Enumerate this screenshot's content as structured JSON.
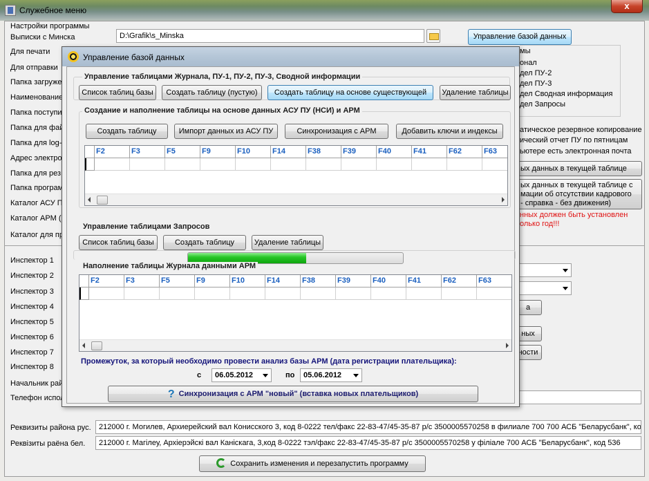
{
  "main": {
    "title": "Служебное меню",
    "close_label": "x",
    "settings_label": "Настройки программы",
    "left_labels": [
      "Выписки с Минска",
      "Для печати",
      "Для отправки",
      "Папка загруже",
      "Наименование",
      "Папка поступи",
      "Папка для фай",
      "Папка для log-",
      "Адрес электро",
      "Папка для рез",
      "Папка програм",
      "Каталог АСУ П",
      "Каталог АРМ (",
      "Каталог для пр"
    ],
    "minsk_path": "D:\\Grafik\\s_Minska",
    "db_button": "Управление базой данных",
    "right_labels": [
      "мы",
      "онал",
      "дел ПУ-2",
      "дел ПУ-3",
      "дел Сводная информация",
      "дел Запросы"
    ],
    "checkbox_labels": [
      "атическое резервное копирование",
      "ический отчет ПУ по пятницам",
      "ьютере есть электронная почта"
    ],
    "btn_current_table": "ых данных в текущей таблице",
    "btn_multi": [
      "ых данных в текущей таблице с",
      "мации об отсутствии кадрового",
      " - справка - без движения)"
    ],
    "warning": [
      "нных должен быть  установлен",
      "олько год!!!"
    ],
    "inspectors": [
      "Инспектор 1",
      "Инспектор 2",
      "Инспектор 3",
      "Инспектор 4",
      "Инспектор 5",
      "Инспектор 6",
      "Инспектор 7",
      "Инспектор 8"
    ],
    "partial_btn_1": "а",
    "partial_btn_2": "ных",
    "partial_btn_3": "ности",
    "chief_label": "Начальник рай",
    "phone_label": "Телефон испол",
    "rekv_rus_label": "Реквизиты района рус.",
    "rekv_rus_value": "212000 г. Могилев, Архиерейский вал Конисского 3, код 8-0222 тел/факс 22-83-47/45-35-87 р/с 3500005570258 в филиале 700 700 АСБ \"Беларусбанк\", код",
    "rekv_bel_label": "Реквізиты раёна бел.",
    "rekv_bel_value": "212000 г. Магілеу, Архіерэйскі вал Каніскага, 3,код 8-0222 тэл/факс 22-83-47/45-35-87 р/с 3500005570258 у філіале 700 АСБ \"Беларусбанк\", код 536",
    "save_button": "Сохранить изменения и перезапустить программу"
  },
  "dialog": {
    "title": "Управление базой данных",
    "group1_title": "Управление таблицами Журнала, ПУ-1, ПУ-2, ПУ-3, Сводной информации",
    "group1_buttons": [
      "Список таблиц базы",
      "Создать таблицу (пустую)",
      "Создать таблицу на основе существующей",
      "Удаление таблицы"
    ],
    "group2_title": "Создание и наполнение таблицы на основе данных АСУ ПУ (НСИ) и АРМ",
    "group2_buttons": [
      "Создать таблицу",
      "Импорт данных из АСУ ПУ",
      "Синхронизация с АРМ",
      "Добавить ключи и индексы"
    ],
    "grid_columns": [
      "F2",
      "F3",
      "F5",
      "F9",
      "F10",
      "F14",
      "F38",
      "F39",
      "F40",
      "F41",
      "F62",
      "F63"
    ],
    "group3_title": "Управление таблицами Запросов",
    "group3_buttons": [
      "Список таблиц базы",
      "Создать таблицу",
      "Удаление таблицы"
    ],
    "progress_fraction": 0.55,
    "group4_title": "Наполнение таблицы Журнала данными АРМ",
    "period_label": "Промежуток, за который необходимо провести анализ базы АРМ (дата регистрации плательщика):",
    "from_label": "с",
    "from_date": "06.05.2012",
    "to_label": "по",
    "to_date": "05.06.2012",
    "sync_button": "Синхронизация с АРМ \"новый\" (вставка новых плательщиков)"
  }
}
